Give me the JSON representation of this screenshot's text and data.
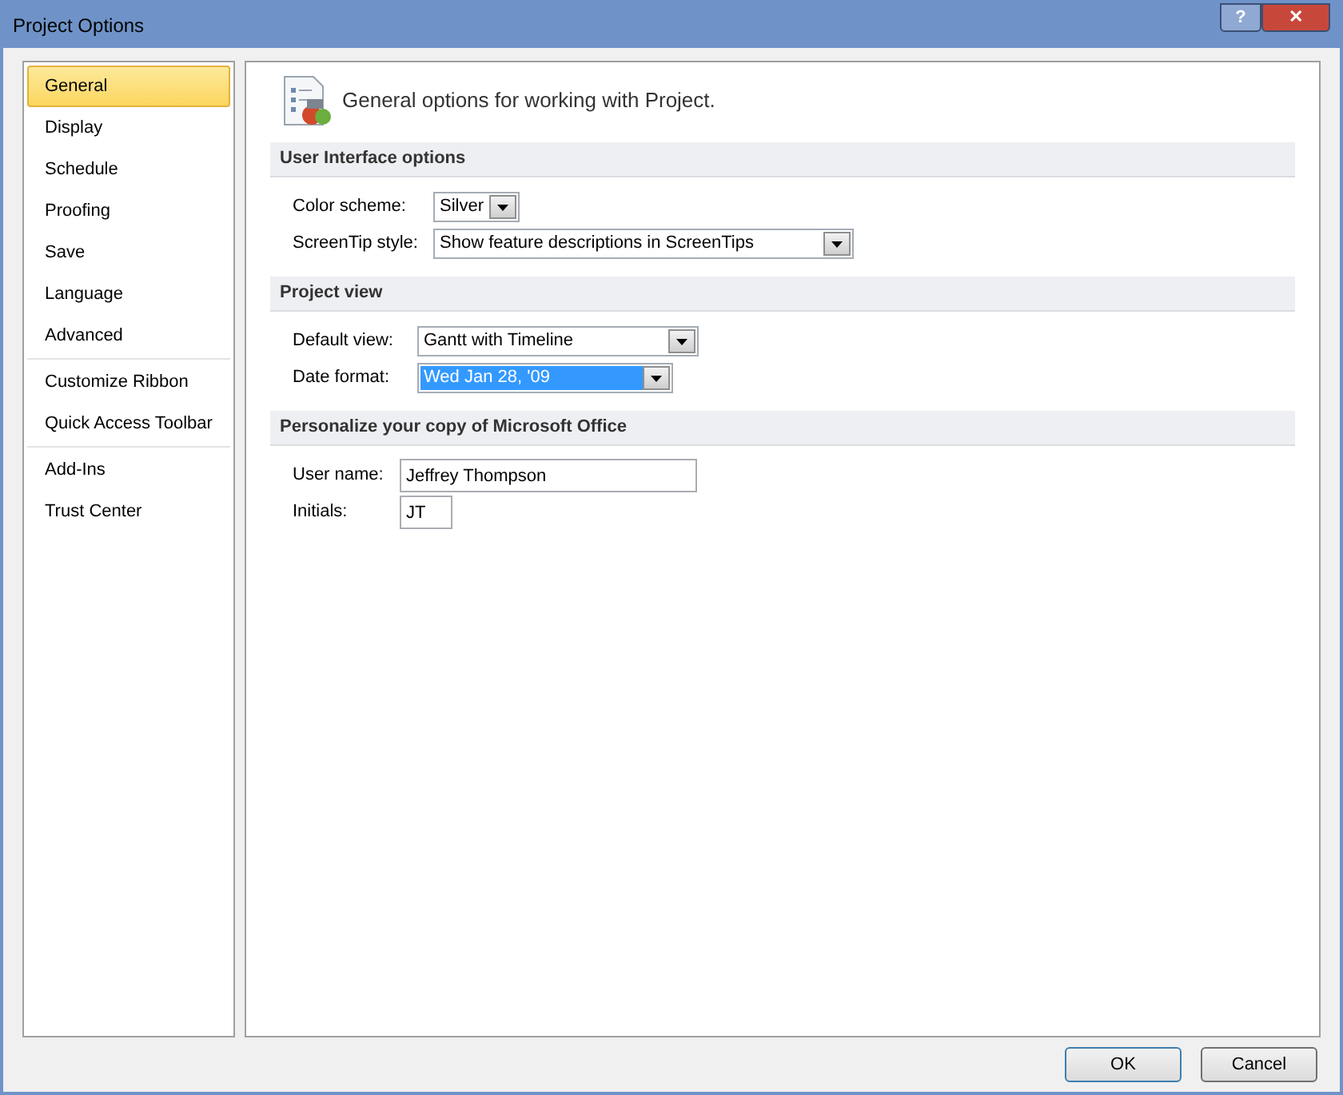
{
  "window": {
    "title": "Project Options",
    "controls": [
      "?",
      "✕"
    ]
  },
  "sidebar": {
    "groups": [
      {
        "items": [
          {
            "label": "General",
            "selected": true
          },
          {
            "label": "Display",
            "selected": false
          },
          {
            "label": "Schedule",
            "selected": false
          },
          {
            "label": "Proofing",
            "selected": false
          },
          {
            "label": "Save",
            "selected": false
          },
          {
            "label": "Language",
            "selected": false
          },
          {
            "label": "Advanced",
            "selected": false
          }
        ]
      },
      {
        "items": [
          {
            "label": "Customize Ribbon",
            "selected": false
          },
          {
            "label": "Quick Access Toolbar",
            "selected": false
          }
        ]
      },
      {
        "items": [
          {
            "label": "Add-Ins",
            "selected": false
          },
          {
            "label": "Trust Center",
            "selected": false
          }
        ]
      }
    ]
  },
  "header": "General options for working with Project.",
  "sections": [
    {
      "title": "User Interface options",
      "fields": [
        {
          "kind": "dropdown",
          "label": "Color scheme:",
          "value": "Silver",
          "selected": false
        },
        {
          "kind": "dropdown",
          "label": "ScreenTip style:",
          "value": "Show feature descriptions in ScreenTips",
          "selected": false
        }
      ]
    },
    {
      "title": "Project view",
      "fields": [
        {
          "kind": "dropdown",
          "label": "Default view:",
          "value": "Gantt with Timeline",
          "selected": false
        },
        {
          "kind": "dropdown",
          "label": "Date format:",
          "value": "Wed Jan 28, '09",
          "selected": true
        }
      ]
    },
    {
      "title": "Personalize your copy of Microsoft Office",
      "fields": [
        {
          "kind": "text",
          "label": "User name:",
          "value": "Jeffrey Thompson"
        },
        {
          "kind": "text",
          "label": "Initials:",
          "value": "JT"
        }
      ]
    }
  ],
  "buttons": [
    "OK",
    "Cancel"
  ]
}
